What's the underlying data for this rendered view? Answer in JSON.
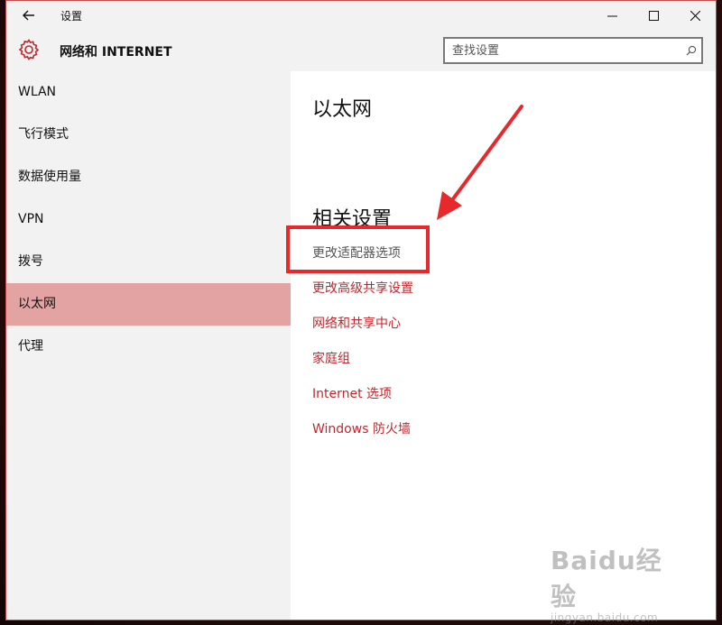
{
  "window": {
    "title": "设置",
    "section_header": "网络和 INTERNET"
  },
  "search": {
    "placeholder": "查找设置"
  },
  "sidebar": {
    "items": [
      {
        "label": "WLAN"
      },
      {
        "label": "飞行模式"
      },
      {
        "label": "数据使用量"
      },
      {
        "label": "VPN"
      },
      {
        "label": "拨号"
      },
      {
        "label": "以太网"
      },
      {
        "label": "代理"
      }
    ],
    "active_index": 5
  },
  "content": {
    "title": "以太网",
    "related_title": "相关设置",
    "links": [
      {
        "label": "更改适配器选项"
      },
      {
        "label": "更改高级共享设置"
      },
      {
        "label": "网络和共享中心"
      },
      {
        "label": "家庭组"
      },
      {
        "label": "Internet 选项"
      },
      {
        "label": "Windows 防火墙"
      }
    ]
  },
  "watermark": {
    "logo": "Baidu经验",
    "url": "jingyan.baidu.com"
  },
  "colors": {
    "accent": "#c0272d",
    "active_nav": "#e3a3a3",
    "annotation": "#e8292c"
  },
  "icons": [
    "back-arrow-icon",
    "minimize-icon",
    "maximize-icon",
    "close-icon",
    "gear-icon",
    "search-icon"
  ]
}
